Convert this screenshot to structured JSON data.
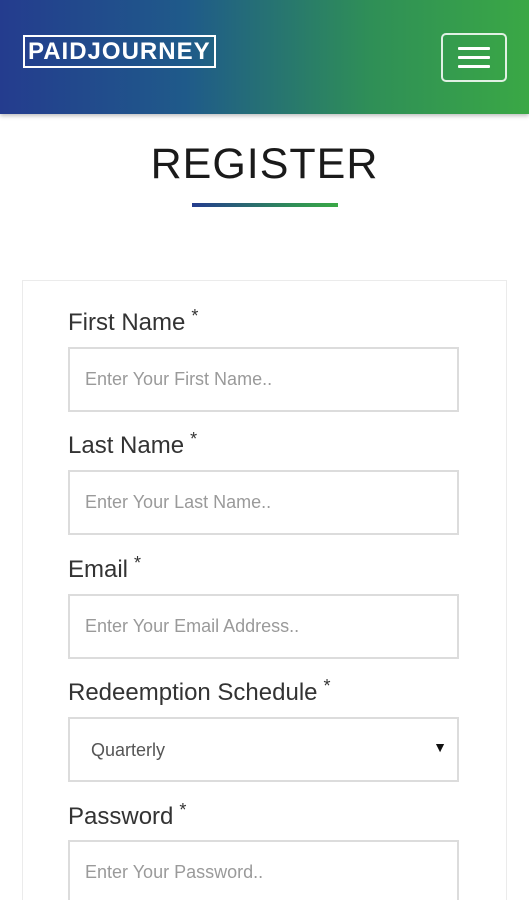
{
  "header": {
    "logo_text": "PAIDJOURNEY",
    "menu_icon": "hamburger-icon"
  },
  "page": {
    "title": "REGISTER"
  },
  "form": {
    "first_name": {
      "label": "First Name",
      "required_mark": "*",
      "placeholder": "Enter Your First Name..",
      "value": ""
    },
    "last_name": {
      "label": "Last Name",
      "required_mark": "*",
      "placeholder": "Enter Your Last Name..",
      "value": ""
    },
    "email": {
      "label": "Email",
      "required_mark": "*",
      "placeholder": "Enter Your Email Address..",
      "value": ""
    },
    "redemption_schedule": {
      "label": "Redeemption Schedule",
      "required_mark": "*",
      "selected": "Quarterly",
      "arrow": "▼"
    },
    "password": {
      "label": "Password",
      "required_mark": "*",
      "placeholder": "Enter Your Password..",
      "value": ""
    }
  },
  "colors": {
    "gradient_start": "#243c8e",
    "gradient_end": "#3aa845"
  }
}
